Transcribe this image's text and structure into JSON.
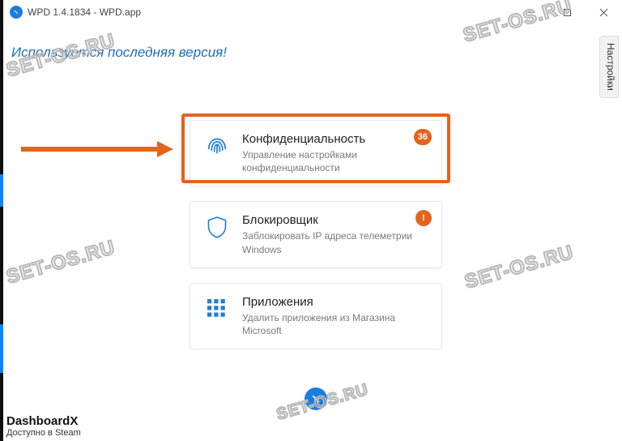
{
  "window": {
    "title": "WPD 1.4.1834 - WPD.app"
  },
  "status": {
    "version_text": "Используется последняя версия!"
  },
  "settings_tab": {
    "label": "Настройки"
  },
  "cards": {
    "privacy": {
      "title": "Конфиденциальность",
      "subtitle": "Управление настройками конфиденциальности",
      "badge": "36"
    },
    "blocker": {
      "title": "Блокировщик",
      "subtitle": "Заблокировать IP адреса телеметрии Windows",
      "badge": "!"
    },
    "apps": {
      "title": "Приложения",
      "subtitle": "Удалить приложения из Магазина Microsoft"
    }
  },
  "footer": {
    "title": "DashboardX",
    "subtitle": "Доступно в Steam"
  },
  "watermark": "SET-OS.RU"
}
